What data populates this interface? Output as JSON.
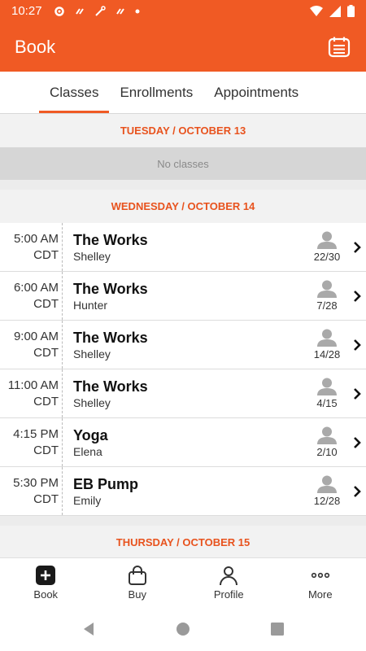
{
  "status_bar": {
    "time": "10:27"
  },
  "app_bar": {
    "title": "Book"
  },
  "tabs": [
    {
      "label": "Classes",
      "active": true
    },
    {
      "label": "Enrollments",
      "active": false
    },
    {
      "label": "Appointments",
      "active": false
    }
  ],
  "days": [
    {
      "header": "TUESDAY / OCTOBER 13",
      "empty_text": "No classes"
    },
    {
      "header": "WEDNESDAY / OCTOBER 14"
    },
    {
      "header": "THURSDAY / OCTOBER 15"
    }
  ],
  "classes": [
    {
      "time": "5:00 AM",
      "tz": "CDT",
      "name": "The Works",
      "instructor": "Shelley",
      "capacity": "22/30"
    },
    {
      "time": "6:00 AM",
      "tz": "CDT",
      "name": "The Works",
      "instructor": "Hunter",
      "capacity": "7/28"
    },
    {
      "time": "9:00 AM",
      "tz": "CDT",
      "name": "The Works",
      "instructor": "Shelley",
      "capacity": "14/28"
    },
    {
      "time": "11:00 AM",
      "tz": "CDT",
      "name": "The Works",
      "instructor": "Shelley",
      "capacity": "4/15"
    },
    {
      "time": "4:15 PM",
      "tz": "CDT",
      "name": "Yoga",
      "instructor": "Elena",
      "capacity": "2/10"
    },
    {
      "time": "5:30 PM",
      "tz": "CDT",
      "name": "EB Pump",
      "instructor": "Emily",
      "capacity": "12/28"
    }
  ],
  "bottom_nav": [
    {
      "label": "Book",
      "icon": "plus-square-icon"
    },
    {
      "label": "Buy",
      "icon": "shopping-bag-icon"
    },
    {
      "label": "Profile",
      "icon": "person-icon"
    },
    {
      "label": "More",
      "icon": "more-dots-icon"
    }
  ],
  "colors": {
    "accent": "#f05a24",
    "day_header_text": "#e8531e"
  }
}
